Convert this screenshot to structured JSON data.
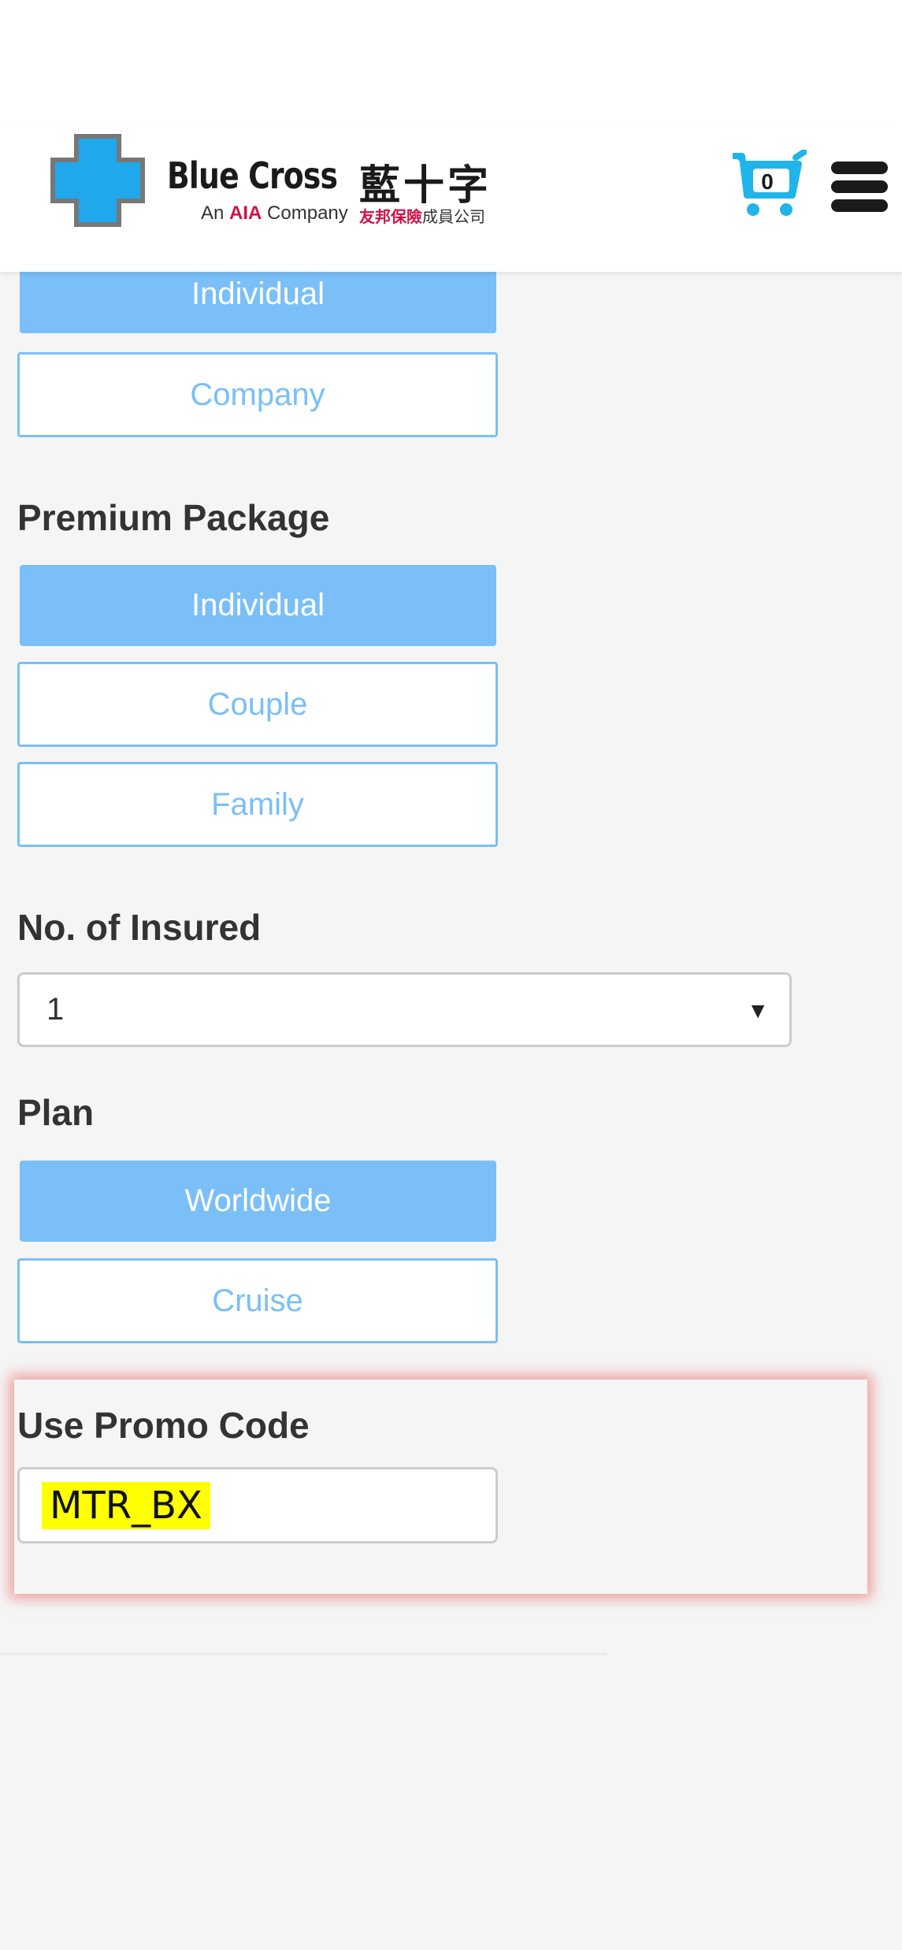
{
  "header": {
    "logo_name": "Blue Cross",
    "logo_name_zh": "藍十字",
    "logo_sub_prefix": "An",
    "logo_sub_brand": "AIA",
    "logo_sub_suffix": "Company",
    "logo_sub_zh_brand": "友邦保險",
    "logo_sub_zh_suffix": "成員公司",
    "cart_count": "0",
    "cart_color": "#1fb5ea",
    "logo_color": "#1fa9ec"
  },
  "applicant": {
    "options": [
      "Individual",
      "Company"
    ],
    "selected": "Individual"
  },
  "premium_package": {
    "label": "Premium Package",
    "options": [
      "Individual",
      "Couple",
      "Family"
    ],
    "selected": "Individual"
  },
  "insured": {
    "label": "No. of Insured",
    "value": "1",
    "arrow": "▼"
  },
  "plan": {
    "label": "Plan",
    "options": [
      "Worldwide",
      "Cruise"
    ],
    "selected": "Worldwide"
  },
  "promo": {
    "label": "Use Promo Code",
    "value": "MTR_BX"
  },
  "colors": {
    "accent": "#7abff7",
    "highlight": "#ffff00",
    "alert_glow": "#e85a5a"
  }
}
